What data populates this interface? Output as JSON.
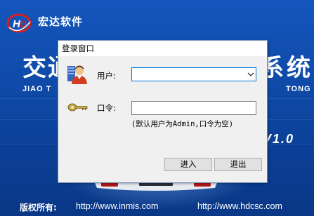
{
  "splash": {
    "company_name": "宏达软件",
    "system_title_left": "交通",
    "system_title_right": "系统",
    "pinyin_left": "JIAO T",
    "pinyin_right": "TONG",
    "version": "V1.0",
    "copyright_label": "版权所有:",
    "url_1": "http://www.inmis.com",
    "url_2": "http://www.hdcsc.com"
  },
  "login_dialog": {
    "title": "登录窗口",
    "username_label": "用户:",
    "username_value": "",
    "password_label": "口令:",
    "password_value": "",
    "hint": "(默认用户为Admin,口令为空)",
    "enter_button": "进入",
    "exit_button": "退出"
  },
  "icons": {
    "logo": "hd-logo",
    "user": "user-icon",
    "key": "key-icon",
    "dropdown": "chevron-down-icon"
  },
  "colors": {
    "background_blue": "#0f4aa8",
    "dialog_background": "#f0f0f0",
    "focus_border": "#0078d7",
    "logo_red": "#d62020"
  }
}
